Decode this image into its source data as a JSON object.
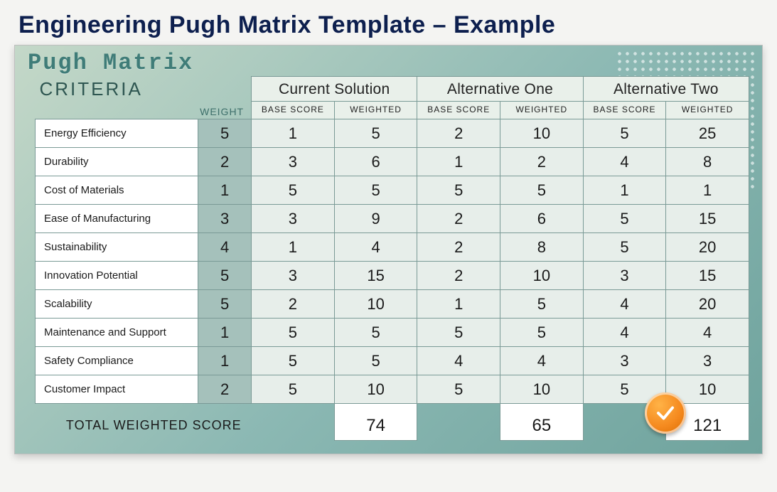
{
  "page_title": "Engineering Pugh Matrix Template – Example",
  "matrix_title": "Pugh Matrix",
  "labels": {
    "criteria": "CRITERIA",
    "weight": "WEIGHT",
    "base_score": "BASE SCORE",
    "weighted": "WEIGHTED",
    "total": "TOTAL WEIGHTED SCORE"
  },
  "alternatives": [
    {
      "name": "Current Solution",
      "total": 74,
      "winner": false
    },
    {
      "name": "Alternative One",
      "total": 65,
      "winner": false
    },
    {
      "name": "Alternative Two",
      "total": 121,
      "winner": true
    }
  ],
  "criteria": [
    {
      "name": "Energy Efficiency",
      "weight": 5,
      "scores": [
        [
          1,
          5
        ],
        [
          2,
          10
        ],
        [
          5,
          25
        ]
      ]
    },
    {
      "name": "Durability",
      "weight": 2,
      "scores": [
        [
          3,
          6
        ],
        [
          1,
          2
        ],
        [
          4,
          8
        ]
      ]
    },
    {
      "name": "Cost of Materials",
      "weight": 1,
      "scores": [
        [
          5,
          5
        ],
        [
          5,
          5
        ],
        [
          1,
          1
        ]
      ]
    },
    {
      "name": "Ease of Manufacturing",
      "weight": 3,
      "scores": [
        [
          3,
          9
        ],
        [
          2,
          6
        ],
        [
          5,
          15
        ]
      ]
    },
    {
      "name": "Sustainability",
      "weight": 4,
      "scores": [
        [
          1,
          4
        ],
        [
          2,
          8
        ],
        [
          5,
          20
        ]
      ]
    },
    {
      "name": "Innovation Potential",
      "weight": 5,
      "scores": [
        [
          3,
          15
        ],
        [
          2,
          10
        ],
        [
          3,
          15
        ]
      ]
    },
    {
      "name": "Scalability",
      "weight": 5,
      "scores": [
        [
          2,
          10
        ],
        [
          1,
          5
        ],
        [
          4,
          20
        ]
      ]
    },
    {
      "name": "Maintenance and Support",
      "weight": 1,
      "scores": [
        [
          5,
          5
        ],
        [
          5,
          5
        ],
        [
          4,
          4
        ]
      ]
    },
    {
      "name": "Safety Compliance",
      "weight": 1,
      "scores": [
        [
          5,
          5
        ],
        [
          4,
          4
        ],
        [
          3,
          3
        ]
      ]
    },
    {
      "name": "Customer Impact",
      "weight": 2,
      "scores": [
        [
          5,
          10
        ],
        [
          5,
          10
        ],
        [
          5,
          10
        ]
      ]
    }
  ],
  "chart_data": {
    "type": "table",
    "title": "Engineering Pugh Matrix Template – Example",
    "criteria": [
      "Energy Efficiency",
      "Durability",
      "Cost of Materials",
      "Ease of Manufacturing",
      "Sustainability",
      "Innovation Potential",
      "Scalability",
      "Maintenance and Support",
      "Safety Compliance",
      "Customer Impact"
    ],
    "weights": [
      5,
      2,
      1,
      3,
      4,
      5,
      5,
      1,
      1,
      2
    ],
    "series": [
      {
        "name": "Current Solution",
        "base_score": [
          1,
          3,
          5,
          3,
          1,
          3,
          2,
          5,
          5,
          5
        ],
        "weighted": [
          5,
          6,
          5,
          9,
          4,
          15,
          10,
          5,
          5,
          10
        ],
        "total_weighted": 74
      },
      {
        "name": "Alternative One",
        "base_score": [
          2,
          1,
          5,
          2,
          2,
          2,
          1,
          5,
          4,
          5
        ],
        "weighted": [
          10,
          2,
          5,
          6,
          8,
          10,
          5,
          5,
          4,
          10
        ],
        "total_weighted": 65
      },
      {
        "name": "Alternative Two",
        "base_score": [
          5,
          4,
          1,
          5,
          5,
          3,
          4,
          4,
          3,
          5
        ],
        "weighted": [
          25,
          8,
          1,
          15,
          20,
          15,
          20,
          4,
          3,
          10
        ],
        "total_weighted": 121
      }
    ],
    "winner": "Alternative Two"
  }
}
